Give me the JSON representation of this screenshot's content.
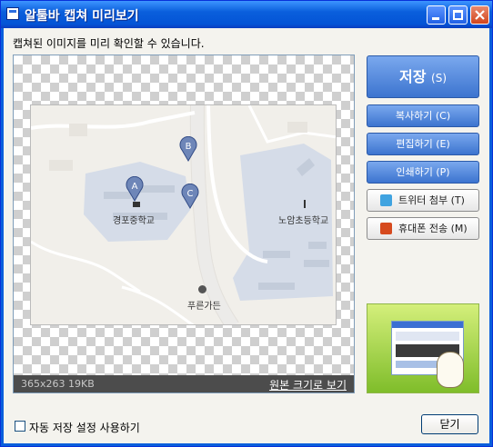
{
  "window": {
    "title": "알툴바 캡쳐 미리보기"
  },
  "subtitle": "캡쳐된 이미지를 미리 확인할 수 있습니다.",
  "preview": {
    "size_info": "365x263  19KB",
    "original_link": "원본 크기로 보기",
    "map": {
      "markers": [
        "A",
        "B",
        "C"
      ],
      "labels": {
        "school1": "경포중학교",
        "school2": "노암초등학교",
        "place": "푸른가든"
      }
    }
  },
  "buttons": {
    "save_label": "저장",
    "save_shortcut": "(S)",
    "copy": "복사하기 (C)",
    "edit": "편집하기 (E)",
    "print": "인쇄하기 (P)",
    "twitter": "트위터 첨부 (T)",
    "mobile": "휴대폰 전송 (M)"
  },
  "footer": {
    "auto_save": "자동 저장 설정 사용하기",
    "close": "닫기"
  },
  "colors": {
    "titlebar": "#0a5fdc",
    "button_blue": "#3c74cf",
    "park": "#d5dce8"
  }
}
